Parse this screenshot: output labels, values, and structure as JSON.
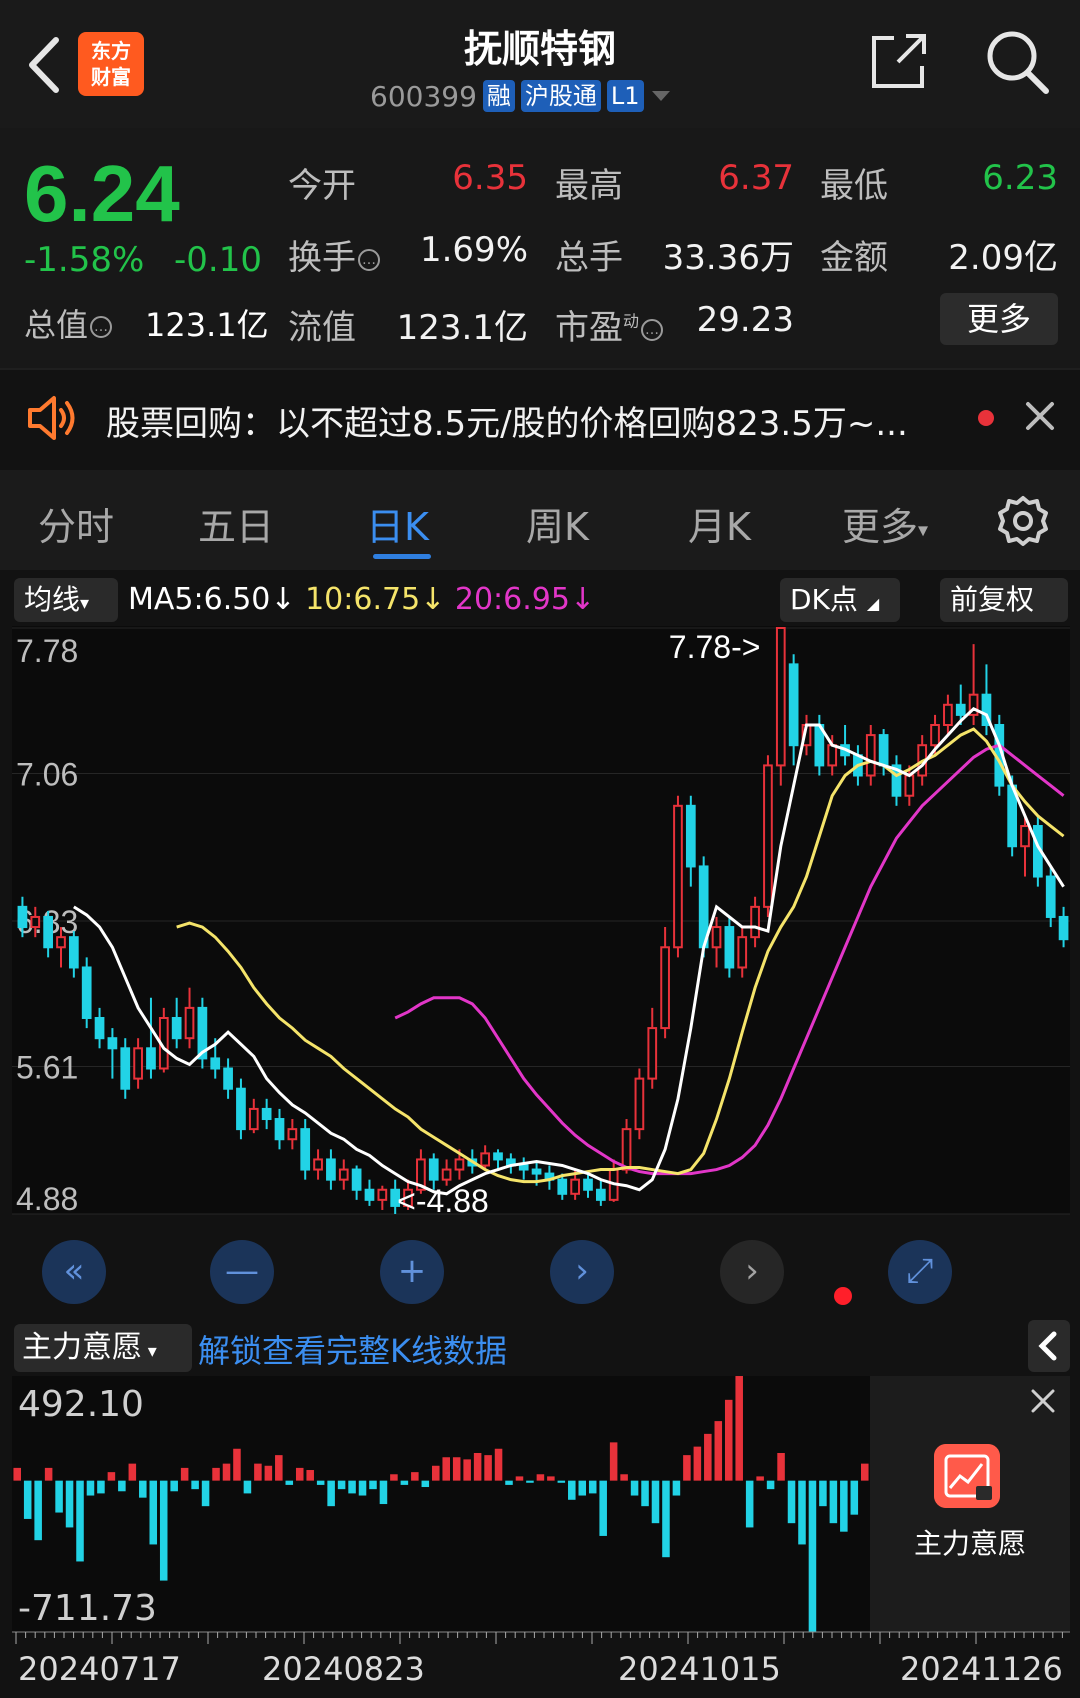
{
  "header": {
    "title": "抚顺特钢",
    "code": "600399",
    "tags": [
      "融",
      "沪股通",
      "L1"
    ],
    "logo_text": [
      "东方",
      "财富"
    ]
  },
  "quote": {
    "price": "6.24",
    "change_pct": "-1.58%",
    "change": "-0.10",
    "market_cap_label": "总值",
    "market_cap": "123.1亿",
    "open_label": "今开",
    "open": "6.35",
    "high_label": "最高",
    "high": "6.37",
    "low_label": "最低",
    "low": "6.23",
    "turnover_label": "换手",
    "turnover": "1.69%",
    "volume_label": "总手",
    "volume": "33.36万",
    "amount_label": "金额",
    "amount": "2.09亿",
    "float_cap_label": "流值",
    "float_cap": "123.1亿",
    "pe_label": "市盈",
    "pe_sup": "动",
    "pe": "29.23",
    "more_label": "更多"
  },
  "notice": {
    "text": "股票回购：以不超过8.5元/股的价格回购823.5万~..."
  },
  "tabs": [
    "分时",
    "五日",
    "日K",
    "周K",
    "月K",
    "更多"
  ],
  "active_tab": "日K",
  "ma": {
    "selector": "均线",
    "ma5": "MA5:6.50↓",
    "ma10": "10:6.75↓",
    "ma20": "20:6.95↓",
    "dk_label": "DK点",
    "adjust_label": "前复权"
  },
  "colors": {
    "up": "#e8323a",
    "down": "#22d3e6",
    "ma5": "#ffffff",
    "ma10": "#f5e46a",
    "ma20": "#e236c8",
    "accent": "#2f7fe0"
  },
  "chart_data": [
    {
      "type": "candlestick",
      "title": "",
      "y_ticks": [
        "7.78",
        "7.06",
        "6.33",
        "5.61",
        "4.88"
      ],
      "ylim": [
        4.88,
        7.78
      ],
      "max_label": "7.78->",
      "min_label": "<-4.88",
      "x_labels": [
        "20240717",
        "20240823",
        "20241015",
        "20241126"
      ],
      "candles": [
        [
          6.4,
          6.3,
          6.45,
          6.25
        ],
        [
          6.3,
          6.35,
          6.4,
          6.25
        ],
        [
          6.35,
          6.2,
          6.38,
          6.15
        ],
        [
          6.2,
          6.25,
          6.3,
          6.1
        ],
        [
          6.25,
          6.1,
          6.28,
          6.05
        ],
        [
          6.1,
          5.85,
          6.15,
          5.8
        ],
        [
          5.85,
          5.75,
          5.9,
          5.7
        ],
        [
          5.75,
          5.7,
          5.8,
          5.55
        ],
        [
          5.7,
          5.5,
          5.75,
          5.45
        ],
        [
          5.55,
          5.7,
          5.75,
          5.5
        ],
        [
          5.7,
          5.6,
          5.95,
          5.55
        ],
        [
          5.6,
          5.85,
          5.9,
          5.58
        ],
        [
          5.85,
          5.75,
          5.95,
          5.7
        ],
        [
          5.75,
          5.9,
          6.0,
          5.7
        ],
        [
          5.9,
          5.65,
          5.95,
          5.6
        ],
        [
          5.65,
          5.6,
          5.75,
          5.55
        ],
        [
          5.6,
          5.5,
          5.65,
          5.45
        ],
        [
          5.5,
          5.3,
          5.55,
          5.25
        ],
        [
          5.3,
          5.4,
          5.45,
          5.28
        ],
        [
          5.4,
          5.35,
          5.45,
          5.3
        ],
        [
          5.35,
          5.25,
          5.4,
          5.2
        ],
        [
          5.25,
          5.3,
          5.35,
          5.2
        ],
        [
          5.3,
          5.1,
          5.35,
          5.05
        ],
        [
          5.1,
          5.15,
          5.2,
          5.05
        ],
        [
          5.15,
          5.05,
          5.2,
          5.0
        ],
        [
          5.05,
          5.1,
          5.15,
          5.0
        ],
        [
          5.1,
          5.0,
          5.12,
          4.95
        ],
        [
          5.0,
          4.95,
          5.05,
          4.92
        ],
        [
          4.95,
          5.0,
          5.02,
          4.9
        ],
        [
          5.0,
          4.92,
          5.05,
          4.88
        ],
        [
          4.92,
          5.0,
          5.05,
          4.9
        ],
        [
          5.0,
          5.15,
          5.2,
          4.98
        ],
        [
          5.15,
          5.05,
          5.18,
          5.0
        ],
        [
          5.05,
          5.1,
          5.15,
          5.02
        ],
        [
          5.1,
          5.15,
          5.2,
          5.05
        ],
        [
          5.15,
          5.12,
          5.2,
          5.08
        ],
        [
          5.12,
          5.18,
          5.22,
          5.1
        ],
        [
          5.18,
          5.15,
          5.2,
          5.1
        ],
        [
          5.15,
          5.12,
          5.18,
          5.08
        ],
        [
          5.12,
          5.1,
          5.16,
          5.05
        ],
        [
          5.1,
          5.08,
          5.14,
          5.02
        ],
        [
          5.08,
          5.05,
          5.12,
          5.0
        ],
        [
          5.05,
          4.98,
          5.08,
          4.95
        ],
        [
          4.98,
          5.05,
          5.1,
          4.95
        ],
        [
          5.05,
          5.0,
          5.08,
          4.96
        ],
        [
          5.0,
          4.95,
          5.05,
          4.92
        ],
        [
          4.95,
          5.1,
          5.15,
          4.94
        ],
        [
          5.1,
          5.3,
          5.35,
          5.08
        ],
        [
          5.3,
          5.55,
          5.6,
          5.25
        ],
        [
          5.55,
          5.8,
          5.9,
          5.5
        ],
        [
          5.8,
          6.2,
          6.3,
          5.75
        ],
        [
          6.2,
          6.9,
          6.95,
          6.15
        ],
        [
          6.9,
          6.6,
          6.95,
          6.5
        ],
        [
          6.6,
          6.2,
          6.65,
          6.15
        ],
        [
          6.2,
          6.3,
          6.35,
          6.1
        ],
        [
          6.3,
          6.1,
          6.35,
          6.05
        ],
        [
          6.1,
          6.25,
          6.3,
          6.05
        ],
        [
          6.25,
          6.4,
          6.45,
          6.2
        ],
        [
          6.4,
          7.1,
          7.15,
          6.35
        ],
        [
          7.1,
          7.78,
          7.78,
          7.0
        ],
        [
          7.6,
          7.2,
          7.65,
          7.1
        ],
        [
          7.2,
          7.3,
          7.35,
          7.15
        ],
        [
          7.3,
          7.1,
          7.35,
          7.05
        ],
        [
          7.1,
          7.2,
          7.25,
          7.05
        ],
        [
          7.2,
          7.15,
          7.3,
          7.1
        ],
        [
          7.15,
          7.05,
          7.2,
          7.0
        ],
        [
          7.05,
          7.25,
          7.3,
          7.0
        ],
        [
          7.25,
          7.1,
          7.28,
          7.05
        ],
        [
          7.1,
          6.95,
          7.15,
          6.9
        ],
        [
          6.95,
          7.05,
          7.1,
          6.9
        ],
        [
          7.05,
          7.2,
          7.25,
          7.0
        ],
        [
          7.2,
          7.3,
          7.35,
          7.15
        ],
        [
          7.3,
          7.4,
          7.45,
          7.25
        ],
        [
          7.4,
          7.35,
          7.5,
          7.3
        ],
        [
          7.35,
          7.45,
          7.7,
          7.3
        ],
        [
          7.45,
          7.3,
          7.6,
          7.25
        ],
        [
          7.3,
          7.0,
          7.35,
          6.95
        ],
        [
          7.0,
          6.7,
          7.05,
          6.65
        ],
        [
          6.7,
          6.8,
          6.85,
          6.55
        ],
        [
          6.8,
          6.55,
          6.85,
          6.5
        ],
        [
          6.55,
          6.35,
          6.6,
          6.3
        ],
        [
          6.35,
          6.24,
          6.4,
          6.2
        ]
      ],
      "ma5": [
        6.4,
        6.36,
        6.3,
        6.2,
        6.05,
        5.9,
        5.8,
        5.7,
        5.65,
        5.62,
        5.68,
        5.72,
        5.78,
        5.72,
        5.66,
        5.55,
        5.48,
        5.42,
        5.38,
        5.33,
        5.28,
        5.25,
        5.2,
        5.17,
        5.12,
        5.08,
        5.04,
        5.02,
        4.99,
        4.98,
        5.02,
        5.05,
        5.08,
        5.1,
        5.12,
        5.13,
        5.14,
        5.13,
        5.12,
        5.1,
        5.08,
        5.05,
        5.03,
        5.02,
        5.0,
        5.05,
        5.2,
        5.45,
        5.8,
        6.2,
        6.4,
        6.35,
        6.3,
        6.3,
        6.28,
        6.7,
        7.0,
        7.3,
        7.3,
        7.2,
        7.18,
        7.15,
        7.12,
        7.1,
        7.08,
        7.05,
        7.1,
        7.18,
        7.25,
        7.32,
        7.38,
        7.35,
        7.2,
        7.0,
        6.85,
        6.7,
        6.6,
        6.5
      ],
      "ma10": [
        6.3,
        6.32,
        6.3,
        6.25,
        6.18,
        6.1,
        6.0,
        5.92,
        5.85,
        5.8,
        5.74,
        5.7,
        5.66,
        5.6,
        5.55,
        5.5,
        5.45,
        5.4,
        5.36,
        5.3,
        5.26,
        5.22,
        5.18,
        5.14,
        5.1,
        5.07,
        5.05,
        5.04,
        5.04,
        5.05,
        5.07,
        5.08,
        5.09,
        5.1,
        5.1,
        5.11,
        5.11,
        5.1,
        5.09,
        5.08,
        5.1,
        5.18,
        5.35,
        5.55,
        5.78,
        6.0,
        6.18,
        6.3,
        6.4,
        6.55,
        6.75,
        6.95,
        7.05,
        7.1,
        7.12,
        7.1,
        7.05,
        7.08,
        7.12,
        7.15,
        7.2,
        7.25,
        7.28,
        7.22,
        7.12,
        7.0,
        6.92,
        6.85,
        6.8,
        6.75
      ],
      "ma20": [
        5.85,
        5.88,
        5.92,
        5.95,
        5.95,
        5.95,
        5.92,
        5.85,
        5.75,
        5.65,
        5.55,
        5.47,
        5.4,
        5.33,
        5.27,
        5.22,
        5.18,
        5.14,
        5.11,
        5.09,
        5.08,
        5.08,
        5.08,
        5.08,
        5.09,
        5.1,
        5.12,
        5.16,
        5.22,
        5.32,
        5.45,
        5.6,
        5.75,
        5.9,
        6.05,
        6.2,
        6.35,
        6.5,
        6.62,
        6.74,
        6.82,
        6.9,
        6.96,
        7.02,
        7.08,
        7.14,
        7.18,
        7.2,
        7.15,
        7.1,
        7.05,
        7.0,
        6.95
      ]
    },
    {
      "type": "bar",
      "title": "主力意愿",
      "ylim": [
        -711.73,
        492.1
      ],
      "y_labels": [
        "492.10",
        "-711.73"
      ],
      "values": [
        60,
        -180,
        -280,
        60,
        -150,
        -220,
        -380,
        -70,
        -60,
        40,
        -50,
        80,
        -80,
        -300,
        -470,
        -50,
        60,
        -40,
        -120,
        60,
        80,
        150,
        -60,
        80,
        70,
        120,
        -20,
        60,
        50,
        -20,
        -120,
        -40,
        -60,
        -70,
        -40,
        -110,
        30,
        -20,
        40,
        -30,
        70,
        110,
        110,
        100,
        130,
        120,
        150,
        -20,
        20,
        -10,
        30,
        20,
        -10,
        -90,
        -70,
        -60,
        -260,
        180,
        30,
        -70,
        -120,
        -200,
        -360,
        -70,
        120,
        160,
        220,
        280,
        380,
        492,
        -220,
        20,
        -40,
        130,
        -200,
        -300,
        -711,
        -120,
        -200,
        -240,
        -160,
        80
      ]
    }
  ],
  "indicator": {
    "selector": "主力意愿",
    "unlock_text": "解锁查看完整K线数据",
    "side_label": "主力意愿"
  }
}
